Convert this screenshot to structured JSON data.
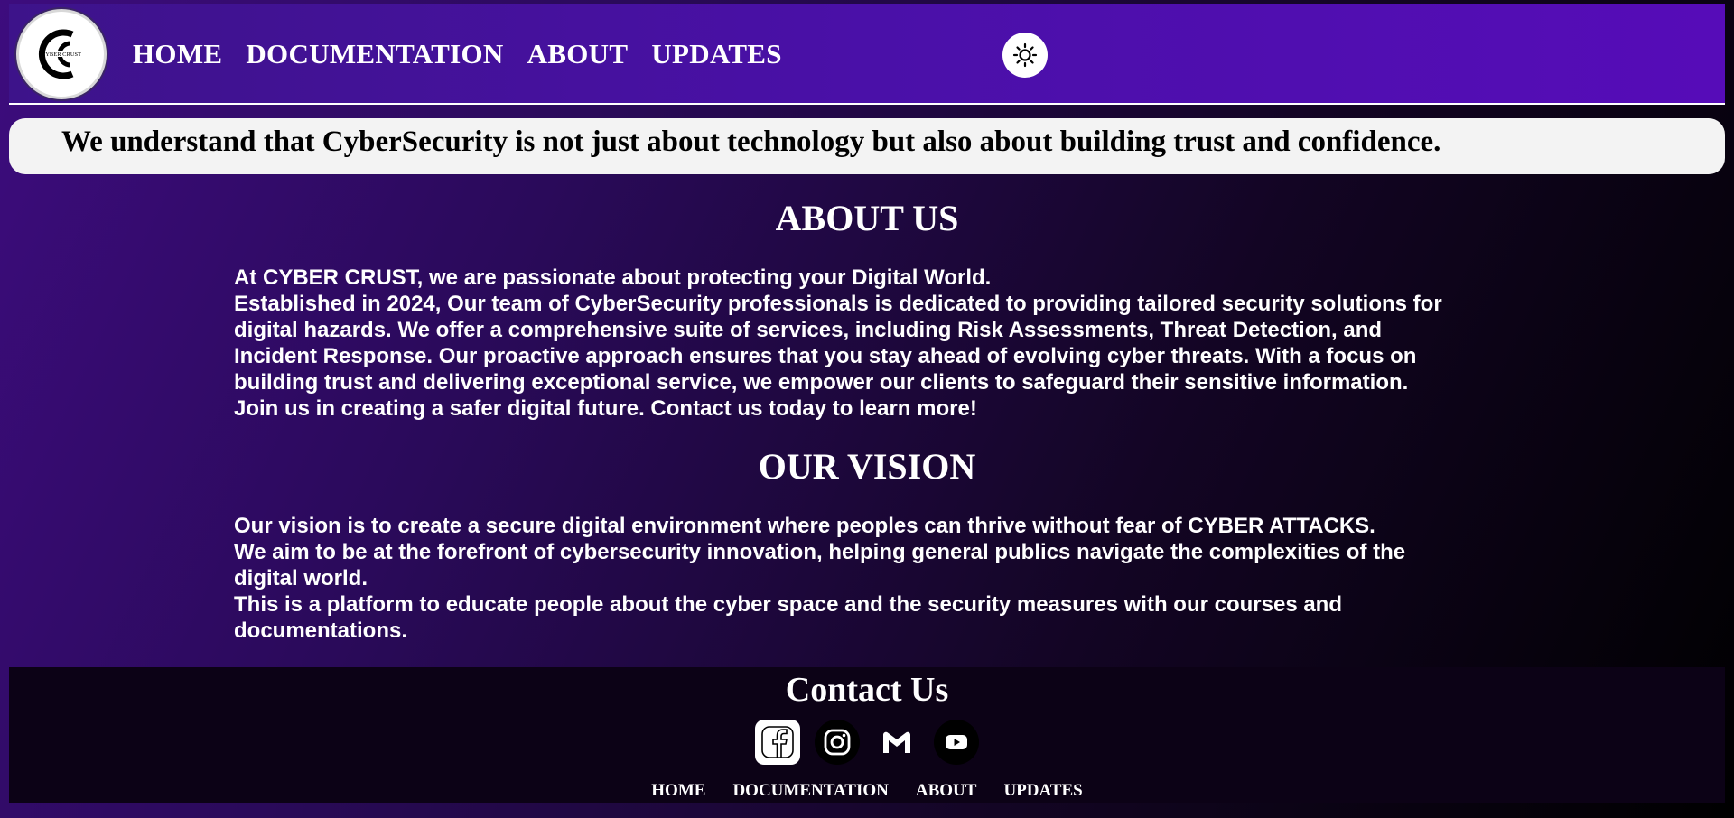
{
  "header": {
    "logo_text": "CYBER CRUST",
    "nav": [
      "HOME",
      "DOCUMENTATION",
      "ABOUT",
      "UPDATES"
    ],
    "theme_icon": "sun-icon"
  },
  "banner": {
    "text": "We understand that CyberSecurity is not just about technology but also about building trust and confidence."
  },
  "about": {
    "title": "ABOUT US",
    "lines": [
      "At CYBER CRUST, we are passionate about protecting your Digital World.",
      "Established in 2024, Our team of CyberSecurity professionals is dedicated to providing tailored security solutions for",
      "digital hazards. We offer a comprehensive suite of services, including Risk Assessments, Threat Detection, and",
      "Incident Response. Our proactive approach ensures that you stay ahead of evolving cyber threats. With a focus on",
      "building trust and delivering exceptional service, we empower our clients to safeguard their sensitive information.",
      "Join us in creating a safer digital future. Contact us today to learn more!"
    ]
  },
  "vision": {
    "title": "OUR VISION",
    "lines": [
      "Our vision is to create a secure digital environment where peoples can thrive without fear of CYBER ATTACKS.",
      "We aim to be at the forefront of cybersecurity innovation, helping general publics navigate the complexities of the",
      "digital world.",
      "This is a platform to educate people about the cyber space and the security measures with our courses and",
      "documentations."
    ]
  },
  "footer": {
    "title": "Contact Us",
    "socials": [
      "facebook-icon",
      "instagram-icon",
      "gmail-icon",
      "youtube-icon"
    ],
    "nav": [
      "HOME",
      "DOCUMENTATION",
      "ABOUT",
      "UPDATES"
    ]
  },
  "colors": {
    "header_start": "#3d138a",
    "header_end": "#560cb8",
    "banner_bg": "#f3f3f3",
    "footer_bg": "#0c0216"
  }
}
